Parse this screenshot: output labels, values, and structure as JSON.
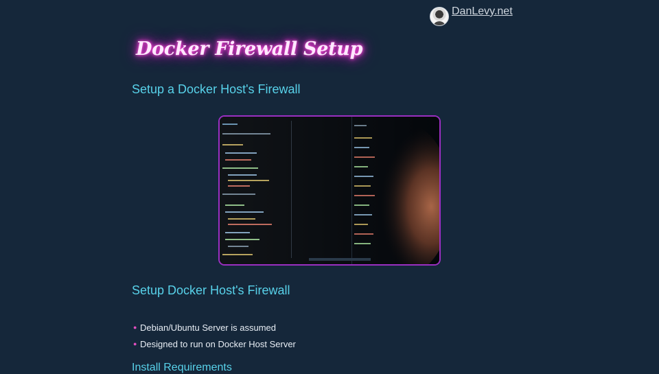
{
  "site": {
    "name": "DanLevy.net"
  },
  "article": {
    "title": "Docker Firewall Setup",
    "subtitle": "Setup a Docker Host's Firewall",
    "section_heading": "Setup Docker Host's Firewall",
    "bullets": [
      "Debian/Ubuntu Server is assumed",
      "Designed to run on Docker Host Server"
    ],
    "next_heading": "Install Requirements"
  },
  "colors": {
    "background": "#15273a",
    "heading": "#58d2ea",
    "neon": "#ff4fd8",
    "hero_border": "#9b2fc2",
    "bullet": "#e14fc0"
  },
  "icons": {
    "avatar": "author-avatar"
  }
}
